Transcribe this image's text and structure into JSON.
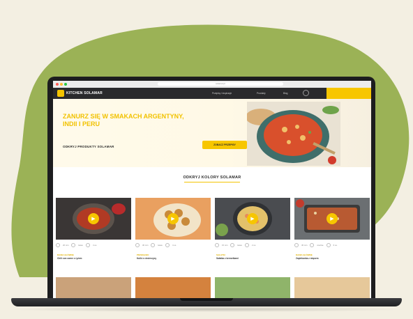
{
  "colors": {
    "background": "#f3efe2",
    "blob": "#9bb256",
    "accent": "#f7c600",
    "header": "#2a2a2c"
  },
  "browser": {
    "url": "solamar.pl"
  },
  "site": {
    "logo_text": "KITCHEN SOLAMAR",
    "nav": [
      "Przepisy i inspiracje",
      "Produkty",
      "Blog"
    ],
    "search_icon": "search-icon"
  },
  "hero": {
    "title": "ZANURZ SIĘ W SMAKACH ARGENTYNY, INDII I PERU",
    "subtitle": "ODKRYJ PRODUKTY SOLAMAR",
    "button": "ZOBACZ PRZEPISY"
  },
  "section": {
    "title": "ODKRYJ KOLORY SOLAMAR"
  },
  "cards": [
    {
      "category": "DANIA GŁÓWNE",
      "name": "Chili con carne z ryżem",
      "meta": [
        "20 min",
        "łatwe",
        "4 os."
      ]
    },
    {
      "category": "PRZEKĄSKI",
      "name": "Kulki z ciecierzycy",
      "meta": [
        "30 min",
        "łatwe",
        "4 os."
      ]
    },
    {
      "category": "SAŁATKI",
      "name": "Sałatka z krewetkami",
      "meta": [
        "15 min",
        "łatwe",
        "2 os."
      ]
    },
    {
      "category": "DANIA GŁÓWNE",
      "name": "Zapiekanka z mięsem",
      "meta": [
        "45 min",
        "średnie",
        "6 os."
      ]
    }
  ]
}
